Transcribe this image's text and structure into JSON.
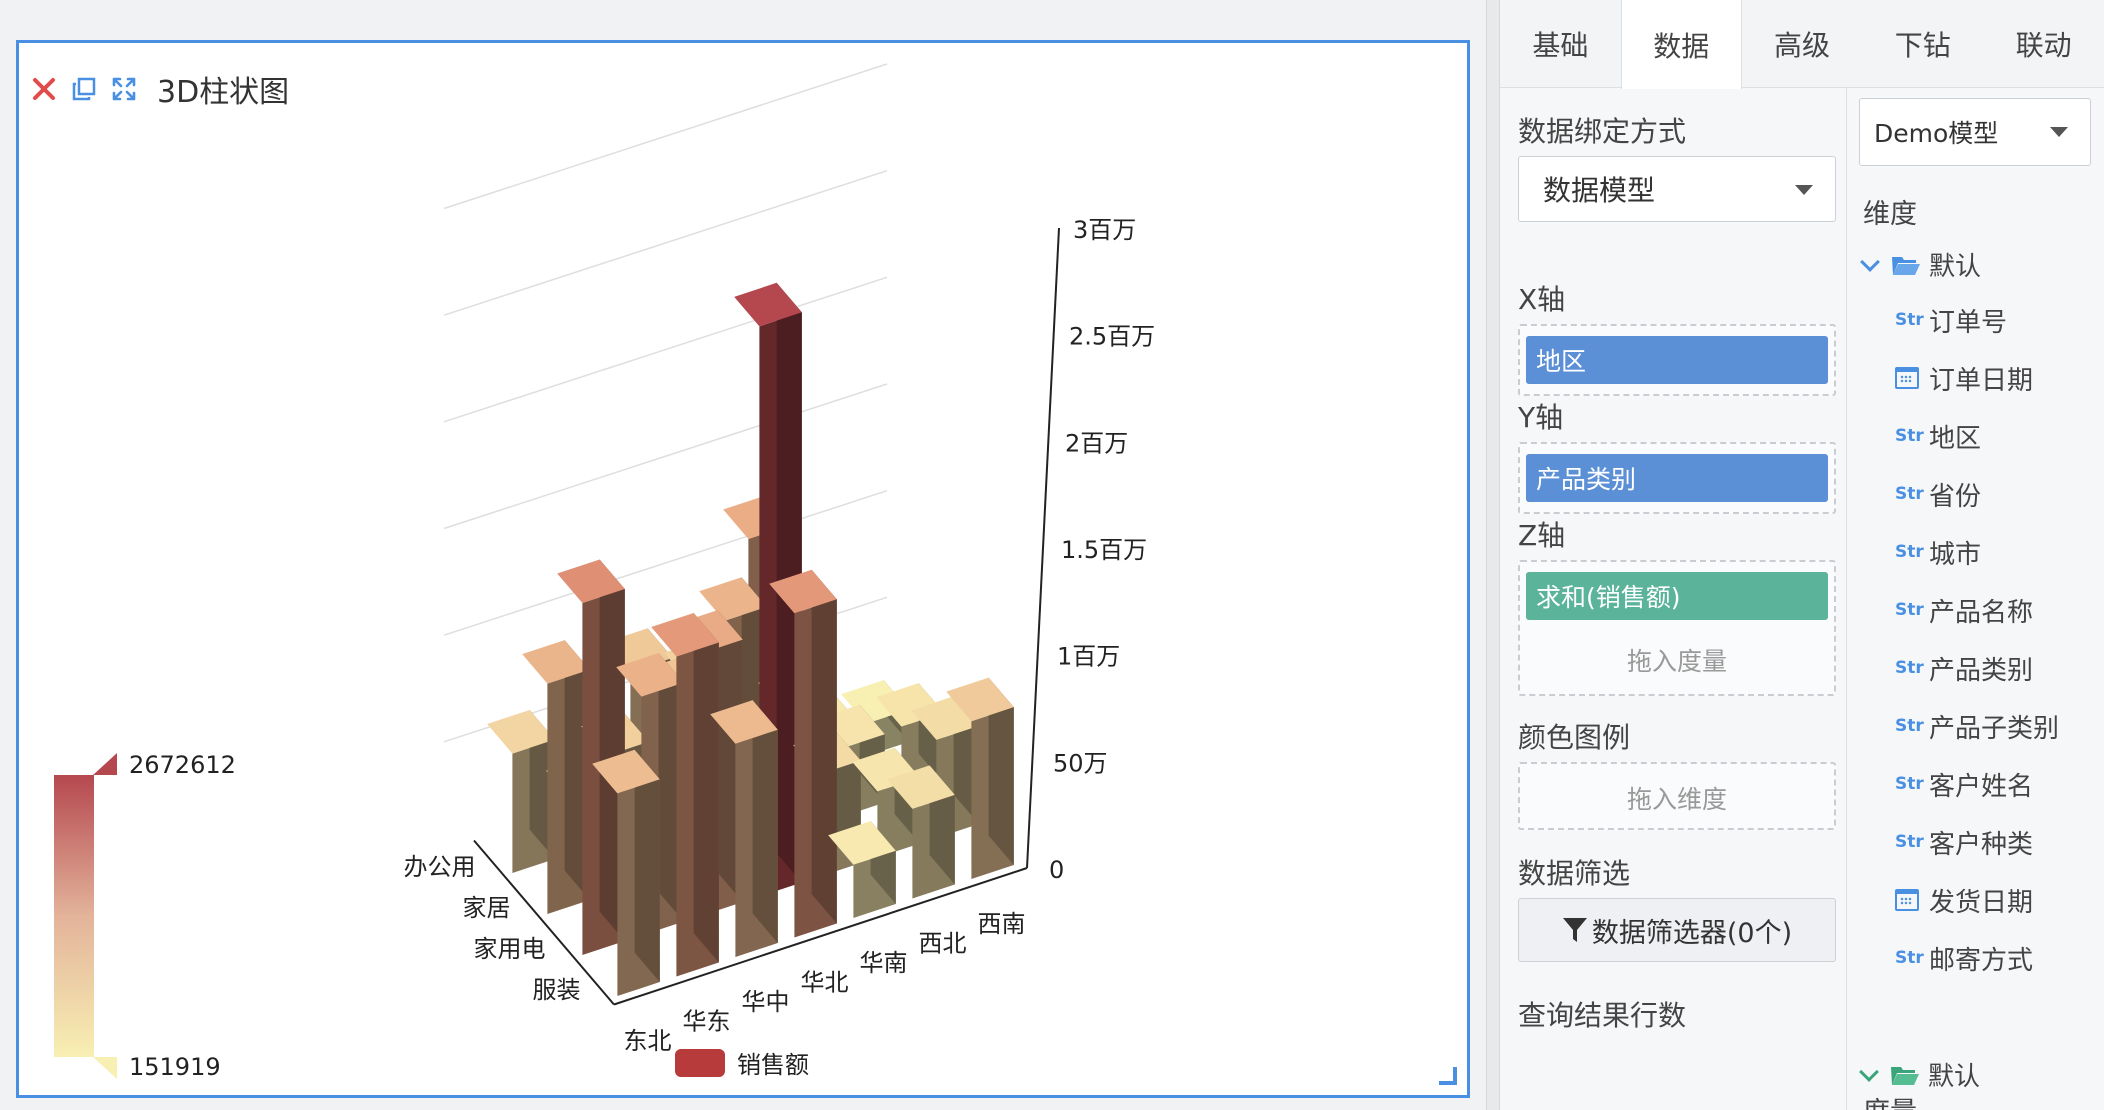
{
  "widget": {
    "title": "3D柱状图",
    "toolbar": [
      "close-icon",
      "copy-icon",
      "fullscreen-icon"
    ]
  },
  "tabs": [
    {
      "label": "基础",
      "active": false
    },
    {
      "label": "数据",
      "active": true
    },
    {
      "label": "高级",
      "active": false
    },
    {
      "label": "下钻",
      "active": false
    },
    {
      "label": "联动",
      "active": false
    }
  ],
  "binding": {
    "method_label": "数据绑定方式",
    "method_value": "数据模型",
    "x_label": "X轴",
    "x_chip": "地区",
    "y_label": "Y轴",
    "y_chip": "产品类别",
    "z_label": "Z轴",
    "z_chip": "求和(销售额)",
    "z_hint": "拖入度量",
    "color_label": "颜色图例",
    "color_hint": "拖入维度",
    "filter_label": "数据筛选",
    "filter_button": "数据筛选器(0个)",
    "result_rows_label": "查询结果行数"
  },
  "fields": {
    "model": "Demo模型",
    "dimension_label": "维度",
    "dimension_folder": "默认",
    "str_tag": "Str",
    "dimensions": [
      {
        "type": "Str",
        "name": "订单号"
      },
      {
        "type": "date",
        "name": "订单日期"
      },
      {
        "type": "Str",
        "name": "地区"
      },
      {
        "type": "Str",
        "name": "省份"
      },
      {
        "type": "Str",
        "name": "城市"
      },
      {
        "type": "Str",
        "name": "产品名称"
      },
      {
        "type": "Str",
        "name": "产品类别"
      },
      {
        "type": "Str",
        "name": "产品子类别"
      },
      {
        "type": "Str",
        "name": "客户姓名"
      },
      {
        "type": "Str",
        "name": "客户种类"
      },
      {
        "type": "date",
        "name": "发货日期"
      },
      {
        "type": "Str",
        "name": "邮寄方式"
      }
    ],
    "measure_label": "度量",
    "measure_folder": "默认"
  },
  "colors": {
    "accent": "#4a90e2",
    "chip_blue": "#5b8fd6",
    "chip_green": "#5bb49a",
    "legend_swatch": "#b83b3b",
    "visual_map_max_color": "#b5484f",
    "visual_map_min_color": "#f8efb3"
  },
  "chart_data": {
    "type": "bar3d",
    "x_categories": [
      "西南",
      "西北",
      "华南",
      "华北",
      "华中",
      "华东",
      "东北"
    ],
    "y_categories": [
      "服装",
      "家用电器",
      "家居",
      "办公用品"
    ],
    "z_ticks": [
      "0",
      "50万",
      "1百万",
      "1.5百万",
      "2百万",
      "2.5百万",
      "3百万"
    ],
    "z_tick_values": [
      0,
      500000,
      1000000,
      1500000,
      2000000,
      2500000,
      3000000
    ],
    "zlim": [
      0,
      3000000
    ],
    "y_tick_labels": [
      "服装",
      "家用电",
      "家居",
      "办公用"
    ],
    "legend": [
      {
        "name": "销售额"
      }
    ],
    "visual_map": {
      "max": "2672612",
      "min": "151919",
      "max_value": 2672612,
      "min_value": 151919
    },
    "series": [
      {
        "name": "销售额",
        "values": [
          [
            740000,
            420000,
            250000,
            1520000,
            1000000,
            1500000,
            950000
          ],
          [
            460000,
            310000,
            480000,
            2672612,
            1230000,
            1120000,
            1650000
          ],
          [
            330000,
            320000,
            580000,
            1100000,
            820000,
            650000,
            1080000
          ],
          [
            151919,
            230000,
            1200000,
            620000,
            760000,
            250000,
            560000
          ]
        ]
      }
    ]
  }
}
